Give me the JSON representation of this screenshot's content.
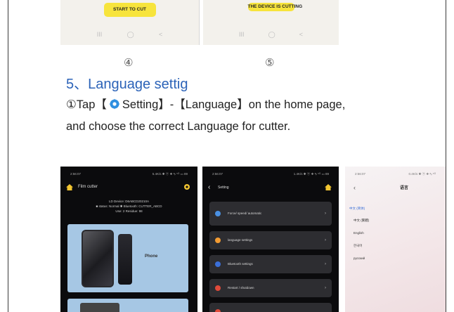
{
  "top_screens": {
    "left": {
      "button": "START TO CUT",
      "nav": [
        "III",
        "◯",
        "<"
      ]
    },
    "right": {
      "button": "THE DEVICE IS CUTTING",
      "nav": [
        "III",
        "◯",
        "<"
      ]
    }
  },
  "steps": {
    "four": "④",
    "five": "⑤"
  },
  "heading": "5、Language settig",
  "instruction": {
    "prefix": "①Tap【",
    "setting": "Setting",
    "mid": "】-【Language】on the home page,",
    "line2": "and choose the correct Language for cutter."
  },
  "screen1": {
    "time": "2:56:07",
    "signal": "5.4K/s ✱ ⓝ ❖ ᵃᵢₗ ⁵ᴳ ▭ 89",
    "title": "Film cutter",
    "device": "LD Device: D6ABCD20210A",
    "status": "■ status: Normal   ✱ Bluetooth: CUTTER_ABCD",
    "uses": "Use: 2   Residue: 98",
    "card_label": "Phone"
  },
  "screen2": {
    "time": "2:56:07",
    "signal": "1.4K/s ✱ ⓝ ❖ ᵃᵢₗ ⁵ᴳ ▭ 89",
    "title": "Setting",
    "rows": [
      {
        "label": "Force/ speed/ automatic",
        "color": "#4a90e2"
      },
      {
        "label": "language settings",
        "color": "#f39c33"
      },
      {
        "label": "Bluetooth settings",
        "color": "#3b6fd8"
      },
      {
        "label": "Restart / shutdown",
        "color": "#e04a3a"
      },
      {
        "label": "",
        "color": "#e04a3a"
      }
    ]
  },
  "screen3": {
    "time": "2:56:07",
    "signal": "0.4K/s ✱ ⓝ ❖ ᵃᵢₗ ⁵ᴳ",
    "title": "语言",
    "languages": [
      "中文 (简体)",
      "中文 (繁體)",
      "English",
      "한국어",
      "русский"
    ]
  },
  "colors": {
    "heading": "#2c63b8",
    "accent_yellow": "#f7e43c",
    "card_blue": "#a6c7e4"
  }
}
